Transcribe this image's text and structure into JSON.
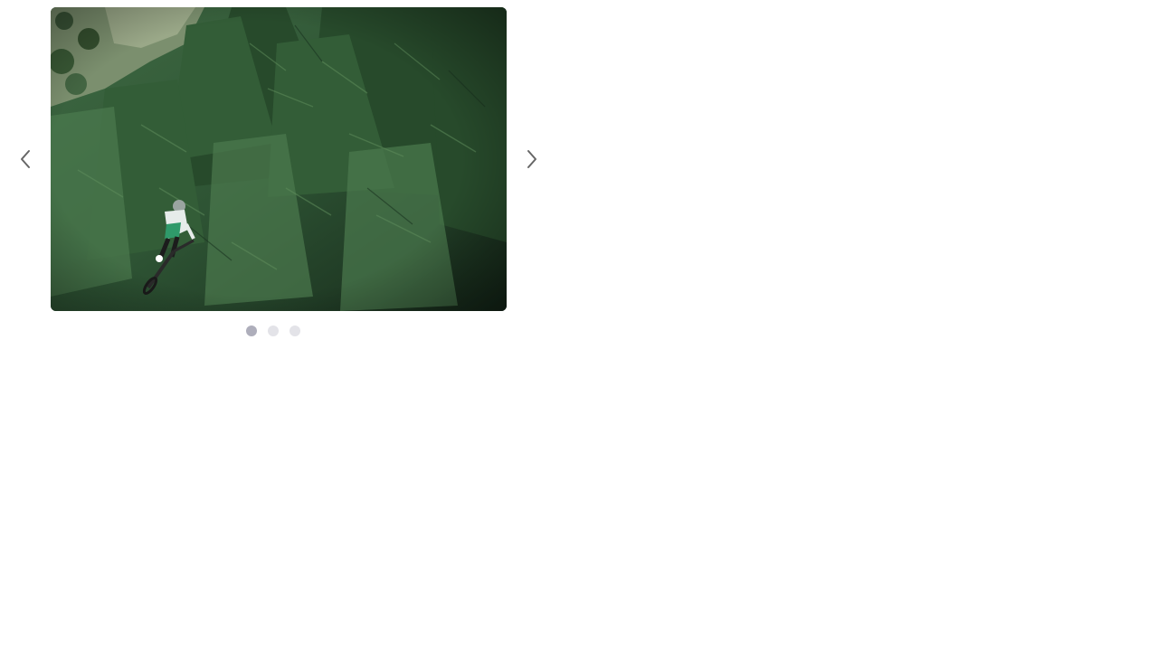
{
  "carousel": {
    "prev_icon": "chevron-left-icon",
    "next_icon": "chevron-right-icon",
    "slide_count": 3,
    "active_slide": 1,
    "slide_image": "mountain-biker-forest-image",
    "colors": {
      "dot_active": "#aeaebb",
      "dot_inactive": "#e3e3e8",
      "chevron": "#666666"
    }
  }
}
